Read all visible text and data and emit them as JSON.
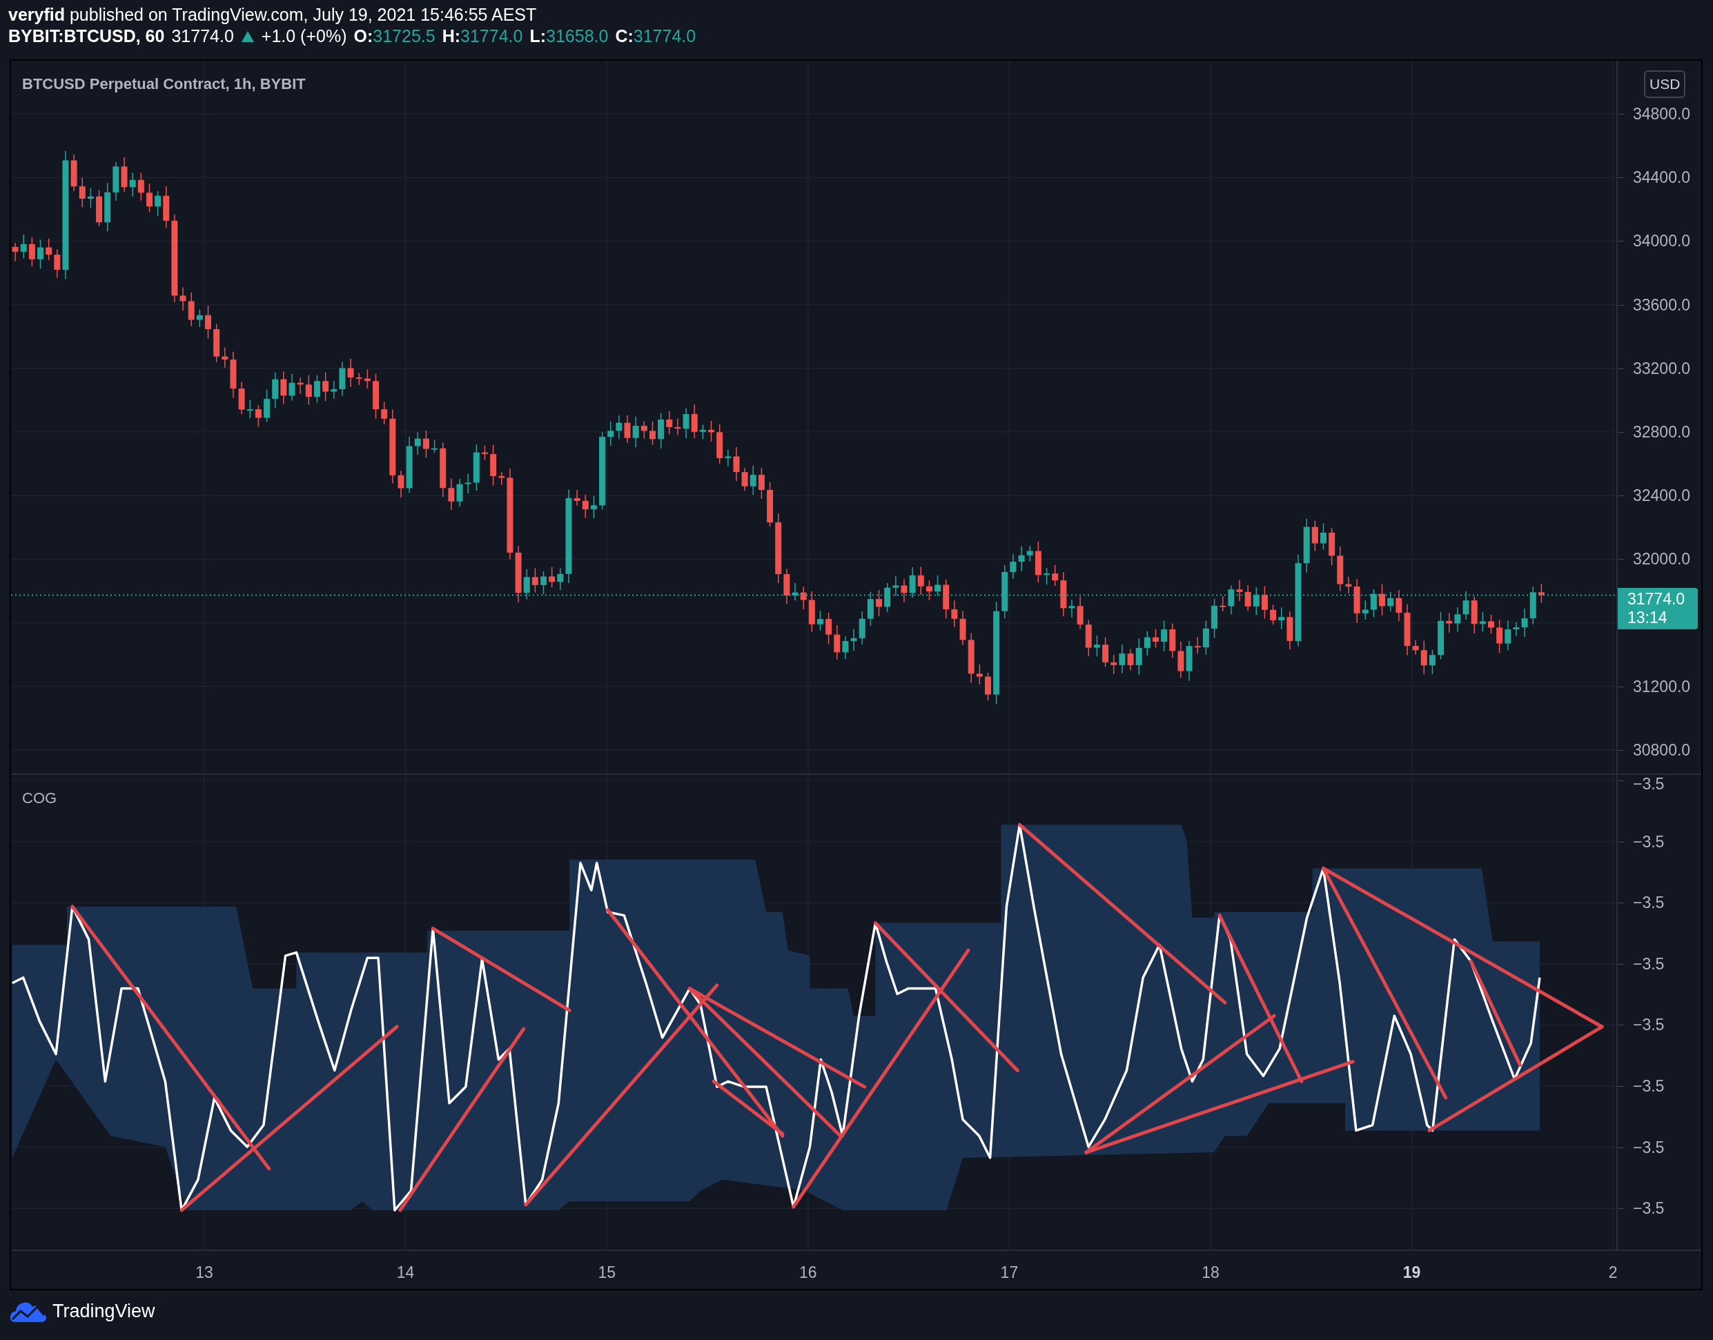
{
  "header": {
    "author": "veryfid",
    "published": "published on TradingView.com, July 19, 2021 15:46:55 AEST"
  },
  "symbol_bar": {
    "symbol": "BYBIT:BTCUSD, 60",
    "last": "31774.0",
    "change": "+1.0 (+0%)",
    "ohlc": [
      {
        "label": "O:",
        "value": "31725.5"
      },
      {
        "label": "H:",
        "value": "31774.0"
      },
      {
        "label": "L:",
        "value": "31658.0"
      },
      {
        "label": "C:",
        "value": "31774.0"
      }
    ]
  },
  "main_pane": {
    "legend": "BTCUSD Perpetual Contract, 1h, BYBIT",
    "currency": "USD",
    "price_ticks": [
      "34800.0",
      "34400.0",
      "34000.0",
      "33600.0",
      "33200.0",
      "32800.0",
      "32400.0",
      "32000.0",
      "31200.0",
      "30800.0"
    ],
    "last_price": {
      "price": "31774.0",
      "countdown": "13:14"
    }
  },
  "indicator_pane": {
    "legend": "COG",
    "ticks": [
      "−3.5",
      "−3.5",
      "−3.5",
      "−3.5",
      "−3.5",
      "−3.5",
      "−3.5",
      "−3.5"
    ]
  },
  "time_axis": {
    "labels": [
      {
        "text": "13",
        "emphasized": false
      },
      {
        "text": "14",
        "emphasized": false
      },
      {
        "text": "15",
        "emphasized": false
      },
      {
        "text": "16",
        "emphasized": false
      },
      {
        "text": "17",
        "emphasized": false
      },
      {
        "text": "18",
        "emphasized": false
      },
      {
        "text": "19",
        "emphasized": true
      },
      {
        "text": "2",
        "emphasized": false
      }
    ]
  },
  "footer": {
    "brand": "TradingView"
  }
}
